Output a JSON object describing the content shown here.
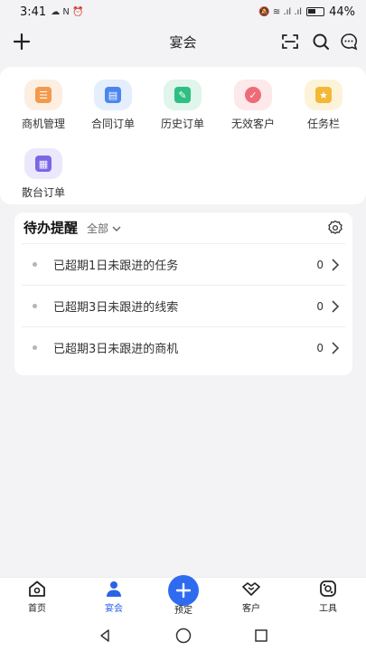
{
  "status_bar": {
    "time": "3:41",
    "battery": "44%"
  },
  "header": {
    "title": "宴会"
  },
  "shortcuts": [
    {
      "label": "商机管理",
      "icon": "briefcase-icon",
      "bg": "#fdeee2",
      "color": "#f39a4c"
    },
    {
      "label": "合同订单",
      "icon": "contract-icon",
      "bg": "#e4eefc",
      "color": "#4b86f0"
    },
    {
      "label": "历史订单",
      "icon": "history-icon",
      "bg": "#e0f5ec",
      "color": "#2fbf83"
    },
    {
      "label": "无效客户",
      "icon": "invalid-customer-icon",
      "bg": "#fde8ea",
      "color": "#ee6b78"
    },
    {
      "label": "任务栏",
      "icon": "task-star-icon",
      "bg": "#fdf3d9",
      "color": "#f2b836"
    },
    {
      "label": "散台订单",
      "icon": "table-order-icon",
      "bg": "#ece8fb",
      "color": "#7b67e6"
    }
  ],
  "todo": {
    "title": "待办提醒",
    "filter": "全部",
    "items": [
      {
        "text": "已超期1日未跟进的任务",
        "count": "0"
      },
      {
        "text": "已超期3日未跟进的线索",
        "count": "0"
      },
      {
        "text": "已超期3日未跟进的商机",
        "count": "0"
      }
    ]
  },
  "tabs": [
    {
      "label": "首页",
      "icon": "home-icon"
    },
    {
      "label": "宴会",
      "icon": "banquet-icon",
      "active": true
    },
    {
      "label": "预定",
      "icon": "plus-icon"
    },
    {
      "label": "客户",
      "icon": "handshake-icon"
    },
    {
      "label": "工具",
      "icon": "tools-icon"
    }
  ],
  "colors": {
    "accent": "#2f6bf0"
  }
}
